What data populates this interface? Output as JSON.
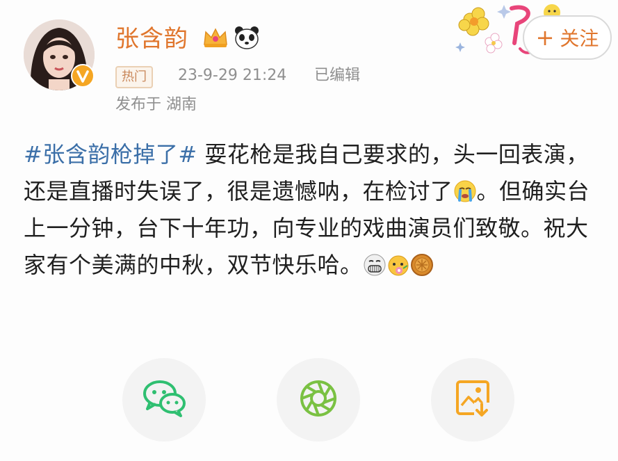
{
  "user": {
    "name": "张含韵",
    "tag": "热门",
    "timestamp": "23-9-29 21:24",
    "edited": "已编辑",
    "location": "发布于 湖南"
  },
  "follow": {
    "label": "关注"
  },
  "post": {
    "hashtag": "#张含韵枪掉了#",
    "line1": "耍花枪是我自己要求的，头一回表演，还是直播时失误了，很是遗憾呐，在检讨了",
    "line2": "。但确实台上一分钟，台下十年功，向专业的戏曲演员们致敬。祝大家有个美满的中秋，双节快乐哈。"
  },
  "icons": {
    "wechat": "wechat-icon",
    "moments": "moments-icon",
    "save_image": "save-image-icon"
  },
  "colors": {
    "name": "#e0762d",
    "hashtag": "#3b6fa8",
    "wechat_green": "#2fbf71"
  }
}
